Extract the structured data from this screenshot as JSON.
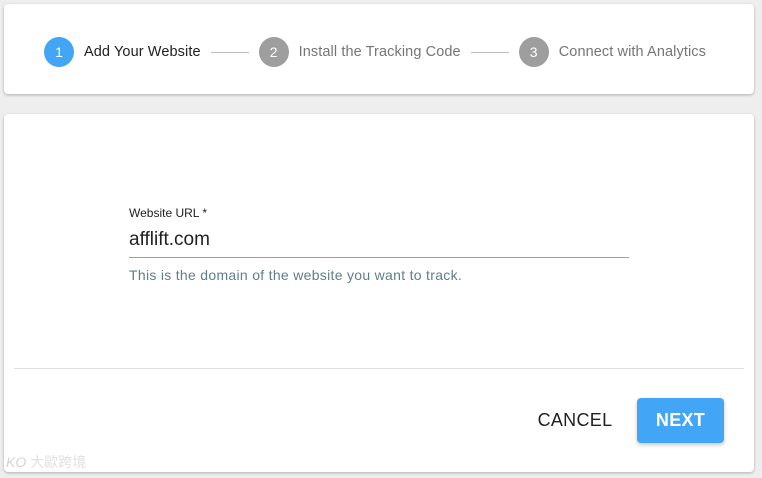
{
  "colors": {
    "active": "#42a5f5",
    "inactive": "#9e9e9e",
    "active_label": "#212121",
    "inactive_label": "#757575",
    "next_button": "#42a5f5"
  },
  "stepper": {
    "steps": [
      {
        "number": "1",
        "label": "Add Your Website",
        "state": "active"
      },
      {
        "number": "2",
        "label": "Install the Tracking Code",
        "state": "inactive"
      },
      {
        "number": "3",
        "label": "Connect with Analytics",
        "state": "inactive"
      }
    ]
  },
  "form": {
    "website_url": {
      "label": "Website URL *",
      "value": "afflift.com",
      "helper": "This is the domain of the website you want to track."
    }
  },
  "actions": {
    "cancel_label": "CANCEL",
    "next_label": "NEXT"
  },
  "watermark": {
    "logo": "KO",
    "text": "大歐跨境"
  }
}
